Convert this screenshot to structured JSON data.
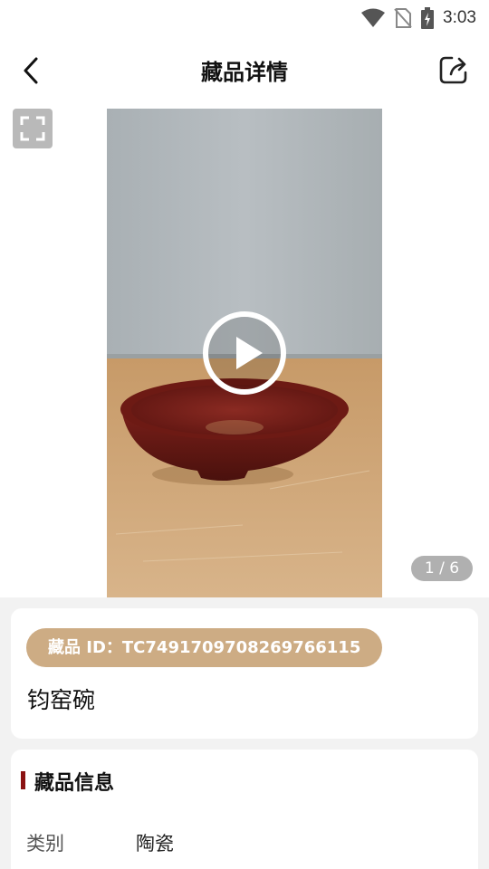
{
  "status_bar": {
    "time": "3:03",
    "icons": [
      "wifi-icon",
      "no-sim-icon",
      "battery-charging-icon"
    ]
  },
  "header": {
    "title": "藏品详情",
    "back_icon": "chevron-left-icon",
    "share_icon": "share-icon"
  },
  "media": {
    "page_indicator": "1 / 6",
    "fullscreen_icon": "fullscreen-icon",
    "play_icon": "play-icon"
  },
  "item": {
    "id_label": "藏品 ID：TC7491709708269766115",
    "name": "钧窑碗"
  },
  "info_section": {
    "title": "藏品信息",
    "rows": [
      {
        "label": "类别",
        "value": "陶瓷"
      }
    ]
  },
  "colors": {
    "id_pill": "#cdac84",
    "section_accent": "#8b1212",
    "background": "#f2f2f2"
  }
}
